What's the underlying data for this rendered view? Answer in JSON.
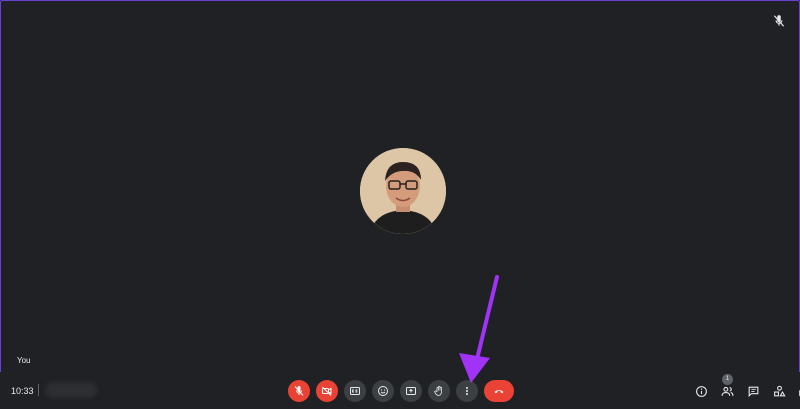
{
  "stage": {
    "self_name": "You",
    "background_color": "#202124"
  },
  "bottom_bar": {
    "clock": "10:33",
    "meeting_code": "abc-defg-hij"
  },
  "controls": [
    {
      "name": "mic-toggle-button",
      "icon": "mic-off-icon",
      "state": "off",
      "color": "#ea4335"
    },
    {
      "name": "camera-toggle-button",
      "icon": "camera-off-icon",
      "state": "off",
      "color": "#ea4335"
    },
    {
      "name": "captions-button",
      "icon": "captions-icon"
    },
    {
      "name": "reactions-button",
      "icon": "emoji-icon"
    },
    {
      "name": "present-screen-button",
      "icon": "present-icon"
    },
    {
      "name": "raise-hand-button",
      "icon": "hand-icon"
    },
    {
      "name": "more-options-button",
      "icon": "more-vertical-icon"
    },
    {
      "name": "leave-call-button",
      "icon": "phone-hangup-icon",
      "color": "#ea4335"
    }
  ],
  "right_controls": {
    "people_count": "1",
    "items": [
      "info-icon",
      "people-icon",
      "chat-icon",
      "activities-icon",
      "host-controls-icon"
    ]
  },
  "annotation": {
    "arrow_color": "#a033f5"
  }
}
